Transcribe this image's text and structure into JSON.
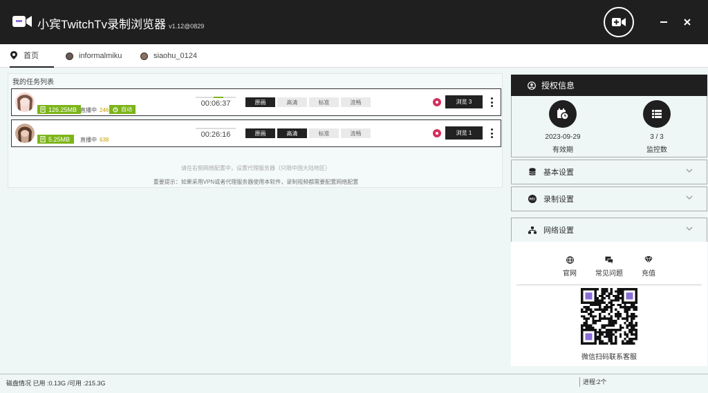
{
  "app": {
    "title": "小宾TwitchTv录制浏览器",
    "version": "v1.12@0829"
  },
  "tabs": [
    {
      "label": "首页",
      "active": true
    },
    {
      "label": "informalmiku",
      "active": false
    },
    {
      "label": "siaohu_0124",
      "active": false
    }
  ],
  "task_list": {
    "title": "我的任务列表",
    "tasks": [
      {
        "size": "126.25MB",
        "status": "直播中",
        "viewers": "246",
        "auto_label": "自动",
        "timer": "00:06:37",
        "qualities": [
          {
            "label": "原画",
            "selected": true
          },
          {
            "label": "高清",
            "selected": false
          },
          {
            "label": "标准",
            "selected": false
          },
          {
            "label": "流畅",
            "selected": false
          }
        ],
        "browse_label": "浏览 3"
      },
      {
        "size": "5.25MB",
        "status": "直播中",
        "viewers": "638",
        "timer": "00:26:16",
        "qualities": [
          {
            "label": "原画",
            "selected": true
          },
          {
            "label": "高清",
            "selected": true
          },
          {
            "label": "标准",
            "selected": false
          },
          {
            "label": "流畅",
            "selected": false
          }
        ],
        "browse_label": "浏览 1"
      }
    ],
    "hint": "请在右侧网络配置中，设置代理服务器（只限中国大陆地区）",
    "important_hint": "重要提示：如果采用VPN或者代理服务器使用本软件，录制视频都需要配置网络配置"
  },
  "auth": {
    "header": "授权信息",
    "expiry_value": "2023-09-29",
    "expiry_label": "有效期",
    "monitor_value": "3 / 3",
    "monitor_label": "监控数"
  },
  "settings": {
    "basic": "基本设置",
    "record": "录制设置",
    "network": "网络设置"
  },
  "links": {
    "website": "官网",
    "faq": "常见问题",
    "recharge": "充值",
    "qr_caption": "微信扫码联系客服"
  },
  "status": {
    "disk": "磁盘情况 已用 :0.13G /可用 :215.3G",
    "process": "进程:2个"
  },
  "colors": {
    "titlebar": "#1f1f1f",
    "accent_green": "#7cb518",
    "record_red": "#d42f5e",
    "qr_purple": "#8a6fd6"
  }
}
